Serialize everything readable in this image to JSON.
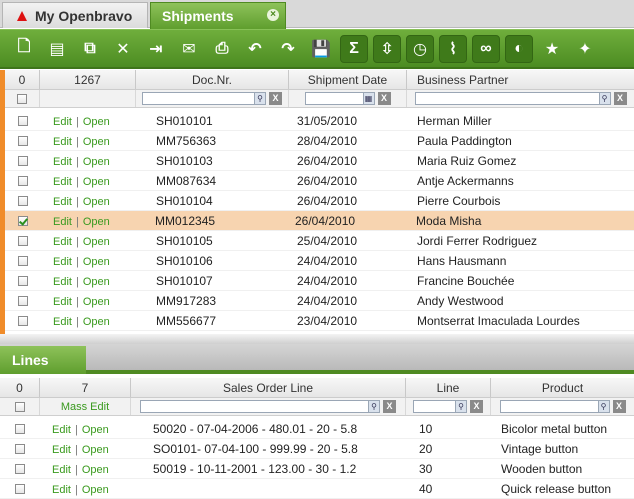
{
  "tabs": {
    "home_label": "My Openbravo",
    "active_label": "Shipments"
  },
  "toolbar": {
    "buttons": [
      "new-document-icon",
      "new-line-icon",
      "copy-icon",
      "delete-icon",
      "export-icon",
      "email-icon",
      "print-icon",
      "undo-icon",
      "redo-icon",
      "save-icon",
      "sum-icon",
      "expand-icon",
      "clock-icon",
      "attachment-icon",
      "link-icon",
      "toggle-icon",
      "favorite-icon",
      "lightbulb-icon"
    ]
  },
  "header_grid": {
    "col0": "0",
    "col1": "1267",
    "col_docnr": "Doc.Nr.",
    "col_date": "Shipment Date",
    "col_bp": "Business Partner",
    "edit_label": "Edit",
    "open_label": "Open",
    "rows": [
      {
        "doc": "SH010101",
        "date": "31/05/2010",
        "bp": "Herman Miller",
        "checked": false
      },
      {
        "doc": "MM756363",
        "date": "28/04/2010",
        "bp": "Paula Paddington",
        "checked": false
      },
      {
        "doc": "SH010103",
        "date": "26/04/2010",
        "bp": "Maria Ruiz Gomez",
        "checked": false
      },
      {
        "doc": "MM087634",
        "date": "26/04/2010",
        "bp": "Antje Ackermanns",
        "checked": false
      },
      {
        "doc": "SH010104",
        "date": "26/04/2010",
        "bp": "Pierre Courbois",
        "checked": false
      },
      {
        "doc": "MM012345",
        "date": "26/04/2010",
        "bp": "Moda Misha",
        "checked": true
      },
      {
        "doc": "SH010105",
        "date": "25/04/2010",
        "bp": "Jordi Ferrer Rodriguez",
        "checked": false
      },
      {
        "doc": "SH010106",
        "date": "24/04/2010",
        "bp": "Hans Hausmann",
        "checked": false
      },
      {
        "doc": "SH010107",
        "date": "24/04/2010",
        "bp": "Francine Bouchée",
        "checked": false
      },
      {
        "doc": "MM917283",
        "date": "24/04/2010",
        "bp": "Andy Westwood",
        "checked": false
      },
      {
        "doc": "MM556677",
        "date": "23/04/2010",
        "bp": "Montserrat Imaculada Lourdes",
        "checked": false
      }
    ]
  },
  "lines_tab": {
    "label": "Lines"
  },
  "lines_grid": {
    "col0": "0",
    "col1": "7",
    "col_sol": "Sales Order Line",
    "col_line": "Line",
    "col_product": "Product",
    "mass_edit": "Mass Edit",
    "rows": [
      {
        "sol": "50020 - 07-04-2006 - 480.01 - 20 - 5.8",
        "line": "10",
        "product": "Bicolor metal button"
      },
      {
        "sol": "SO0101- 07-04-100 - 999.99 - 20 - 5.8",
        "line": "20",
        "product": "Vintage button"
      },
      {
        "sol": "50019 - 10-11-2001 - 123.00 - 30 - 1.2",
        "line": "30",
        "product": "Wooden button"
      },
      {
        "sol": "",
        "line": "40",
        "product": "Quick release button"
      }
    ]
  }
}
